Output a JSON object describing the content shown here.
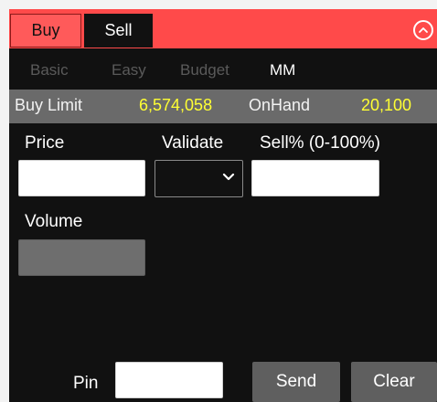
{
  "header": {
    "buy_label": "Buy",
    "sell_label": "Sell",
    "collapse_icon": "chevron-up-circle-icon"
  },
  "tabs": [
    {
      "label": "Basic",
      "active": false
    },
    {
      "label": "Easy",
      "active": false
    },
    {
      "label": "Budget",
      "active": false
    },
    {
      "label": "MM",
      "active": true
    }
  ],
  "info": {
    "buy_limit_label": "Buy Limit",
    "buy_limit_value": "6,574,058",
    "onhand_label": "OnHand",
    "onhand_value": "20,100"
  },
  "form": {
    "price_label": "Price",
    "price_value": "",
    "validate_label": "Validate",
    "validate_value": "",
    "sell_pct_label": "Sell% (0-100%)",
    "sell_pct_value": "",
    "volume_label": "Volume",
    "volume_value": "",
    "pin_label": "Pin",
    "pin_value": ""
  },
  "actions": {
    "send_label": "Send",
    "clear_label": "Clear"
  },
  "colors": {
    "accent_red": "#ff4a4a",
    "value_yellow": "#ffff33",
    "panel_bg": "#111111"
  }
}
